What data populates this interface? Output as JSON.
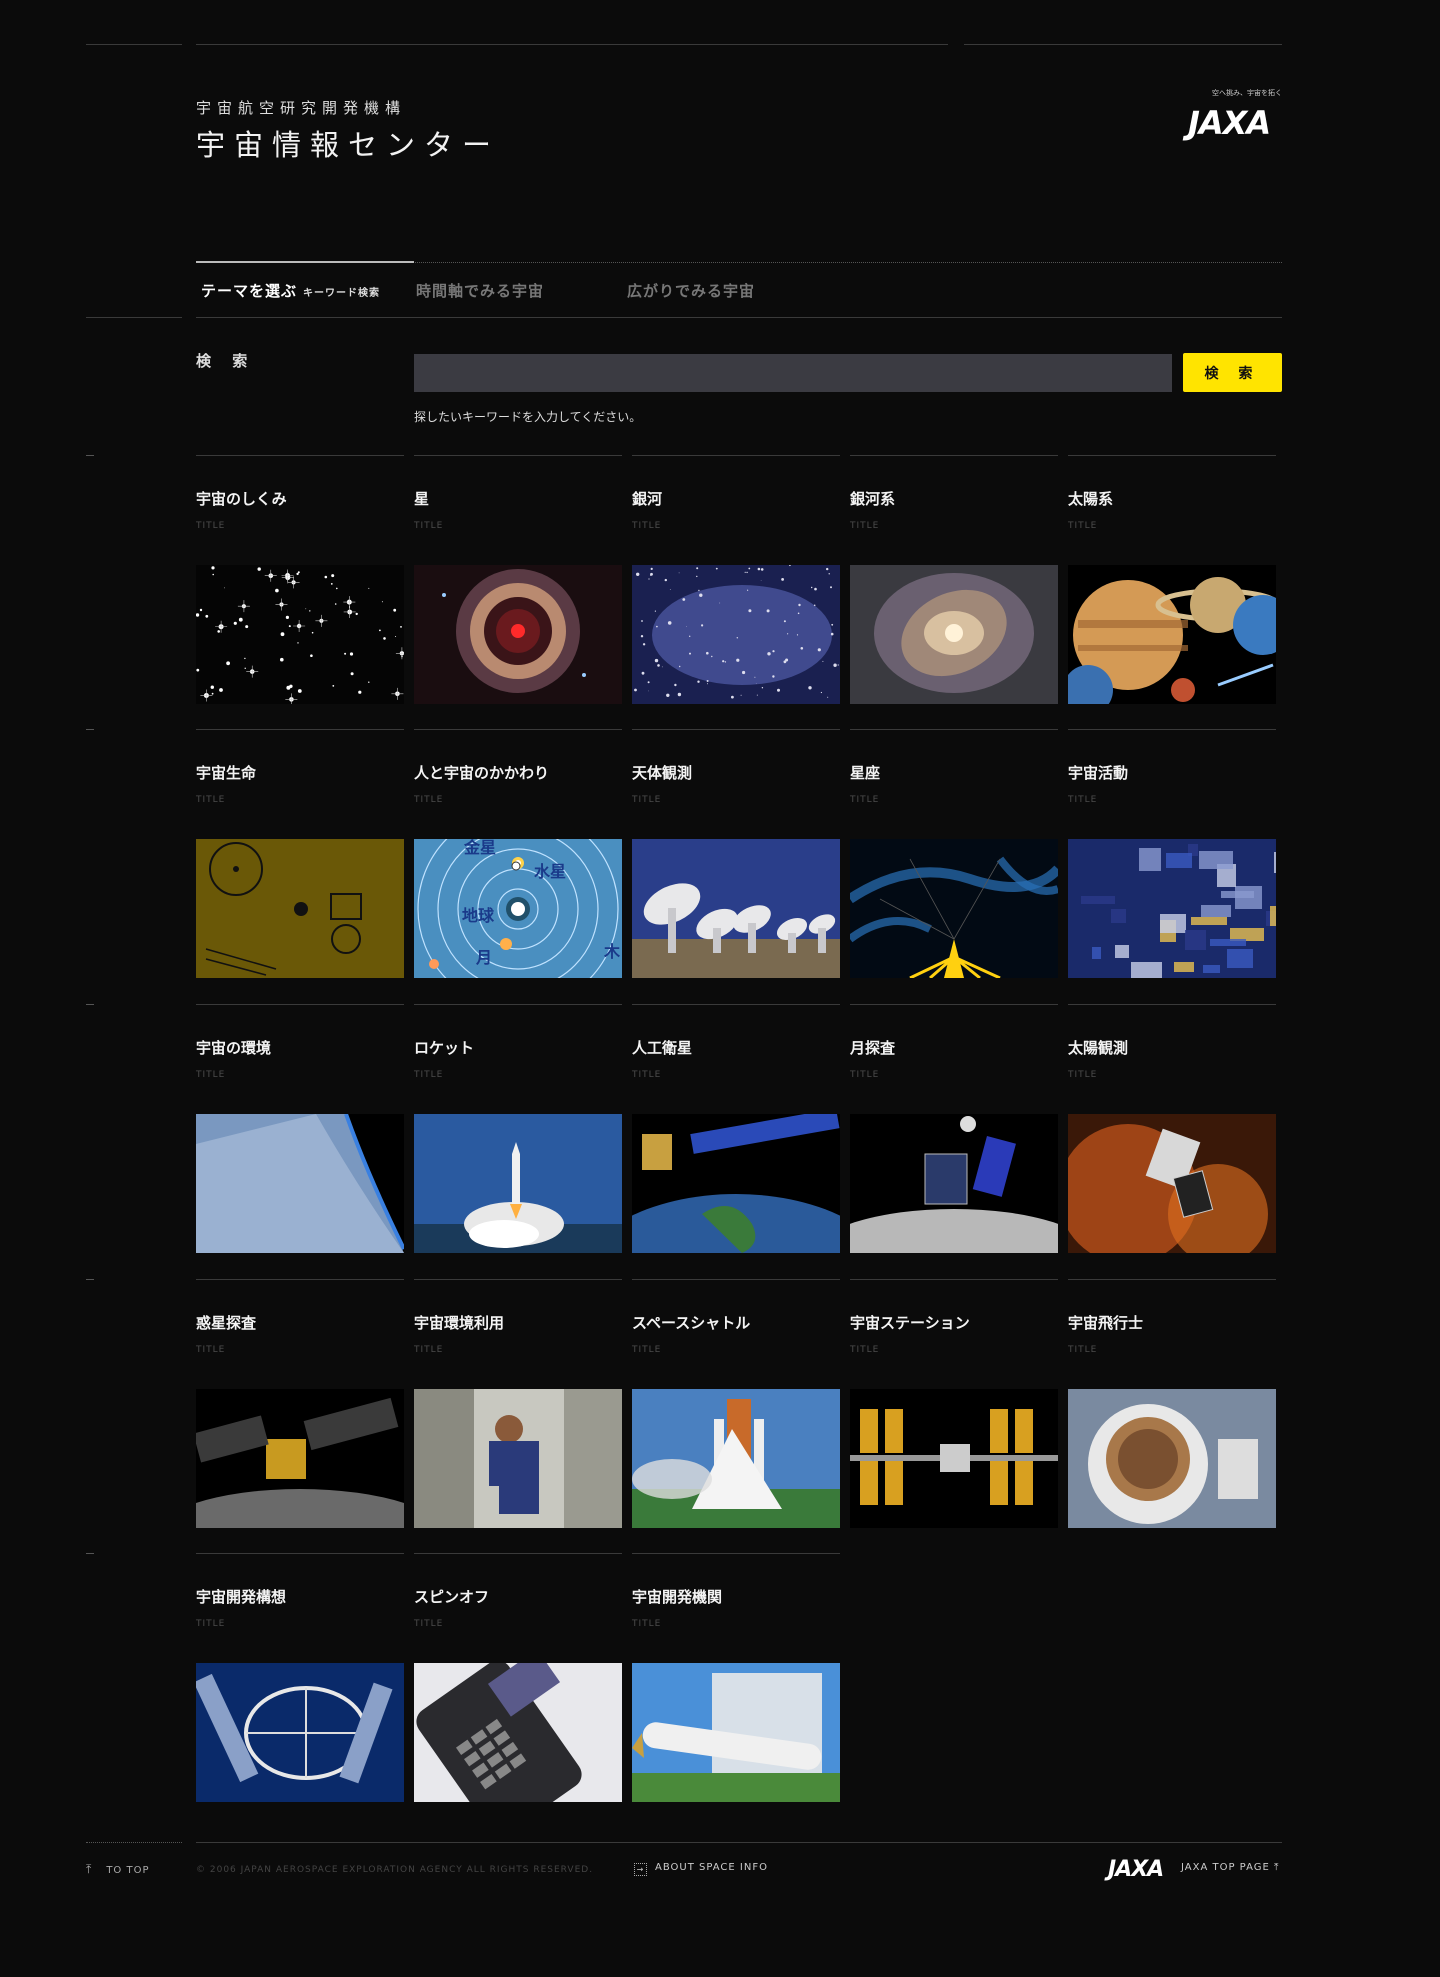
{
  "header": {
    "org_name": "宇宙航空研究開発機構",
    "site_title": "宇宙情報センター",
    "logo_tagline": "空へ挑み、宇宙を拓く",
    "logo_text": "JAXA"
  },
  "tabs": [
    {
      "label": "テーマを選ぶ",
      "sub": "キーワード検索"
    },
    {
      "label": "時間軸でみる宇宙"
    },
    {
      "label": "広がりでみる宇宙"
    }
  ],
  "search": {
    "label": "検 索",
    "value": "",
    "placeholder": "",
    "button": "検 索",
    "hint": "探したいキーワードを入力してください。"
  },
  "cards": [
    {
      "title": "宇宙のしくみ",
      "sub": "TITLE",
      "image": "star-field"
    },
    {
      "title": "星",
      "sub": "TITLE",
      "image": "red-star-nebula"
    },
    {
      "title": "銀河",
      "sub": "TITLE",
      "image": "blue-galaxy-cluster"
    },
    {
      "title": "銀河系",
      "sub": "TITLE",
      "image": "spiral-galaxy"
    },
    {
      "title": "太陽系",
      "sub": "TITLE",
      "image": "planets"
    },
    {
      "title": "宇宙生命",
      "sub": "TITLE",
      "image": "golden-record"
    },
    {
      "title": "人と宇宙のかかわり",
      "sub": "TITLE",
      "image": "solar-system-map",
      "labels": [
        "金星",
        "水星",
        "地球",
        "月",
        "木"
      ]
    },
    {
      "title": "天体観測",
      "sub": "TITLE",
      "image": "radio-telescopes"
    },
    {
      "title": "星座",
      "sub": "TITLE",
      "image": "constellation-chart"
    },
    {
      "title": "宇宙活動",
      "sub": "TITLE",
      "image": "space-activity-collage"
    },
    {
      "title": "宇宙の環境",
      "sub": "TITLE",
      "image": "earth-horizon"
    },
    {
      "title": "ロケット",
      "sub": "TITLE",
      "image": "rocket-launch"
    },
    {
      "title": "人工衛星",
      "sub": "TITLE",
      "image": "satellite-over-earth"
    },
    {
      "title": "月探査",
      "sub": "TITLE",
      "image": "lunar-orbiter"
    },
    {
      "title": "太陽観測",
      "sub": "TITLE",
      "image": "solar-observatory"
    },
    {
      "title": "惑星探査",
      "sub": "TITLE",
      "image": "asteroid-probe"
    },
    {
      "title": "宇宙環境利用",
      "sub": "TITLE",
      "image": "astronaut-in-lab"
    },
    {
      "title": "スペースシャトル",
      "sub": "TITLE",
      "image": "space-shuttle"
    },
    {
      "title": "宇宙ステーション",
      "sub": "TITLE",
      "image": "space-station"
    },
    {
      "title": "宇宙飛行士",
      "sub": "TITLE",
      "image": "astronaut-eva"
    },
    {
      "title": "宇宙開発構想",
      "sub": "TITLE",
      "image": "space-structure"
    },
    {
      "title": "スピンオフ",
      "sub": "TITLE",
      "image": "mobile-phone"
    },
    {
      "title": "宇宙開発機関",
      "sub": "TITLE",
      "image": "space-center-building"
    }
  ],
  "footer": {
    "to_top": "TO TOP",
    "copyright": "© 2006 JAPAN AEROSPACE EXPLORATION AGENCY ALL RIGHTS RESERVED.",
    "about": "ABOUT SPACE INFO",
    "logo_text": "JAXA",
    "jaxa_top": "JAXA TOP PAGE"
  },
  "colors": {
    "background": "#0b0b0b",
    "accent": "#ffe400",
    "search_field": "#3b3b42"
  }
}
